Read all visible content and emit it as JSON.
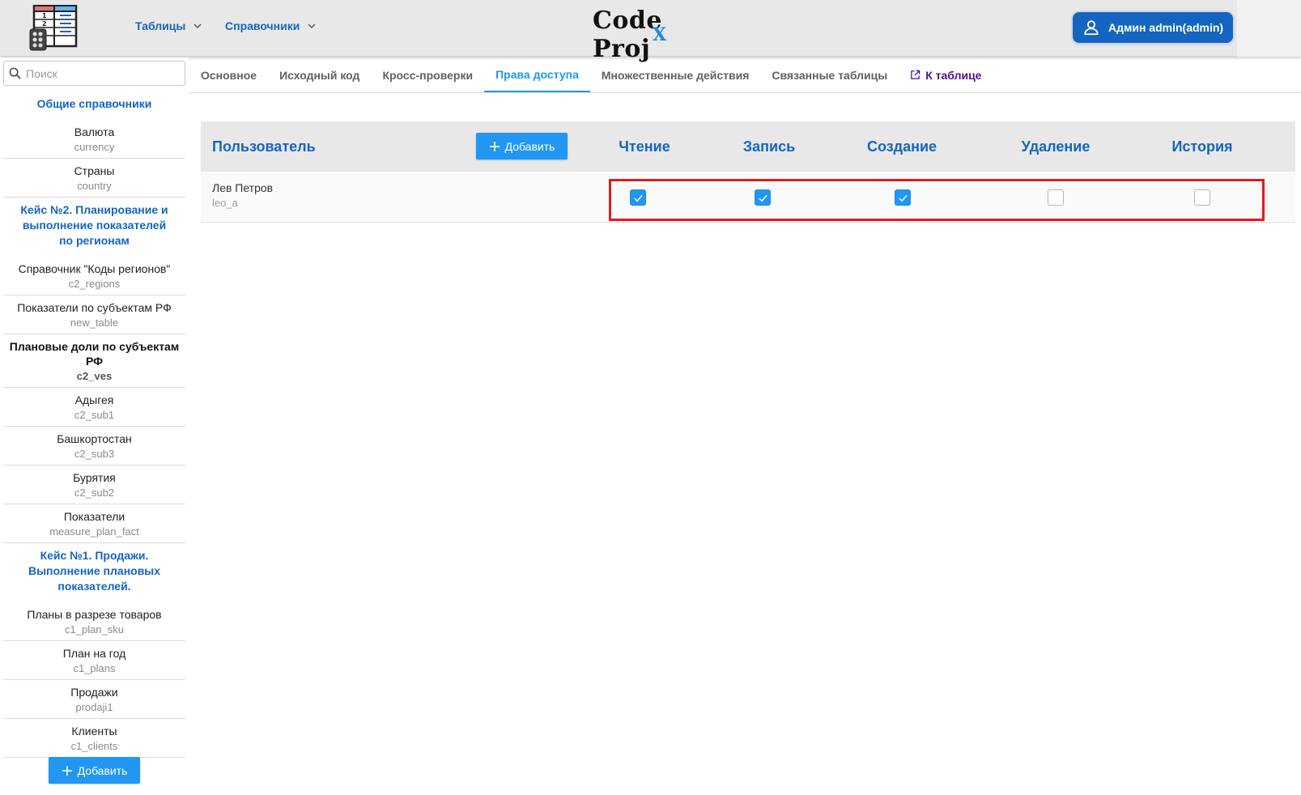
{
  "header": {
    "menu": [
      {
        "label": "Таблицы"
      },
      {
        "label": "Справочники"
      }
    ],
    "brand": {
      "main": "Code Proj",
      "accent": "X"
    },
    "user_label": "Админ admin(admin)"
  },
  "sidebar": {
    "search_placeholder": "Поиск",
    "groups": [
      {
        "title": "Общие справочники",
        "items": [
          {
            "title": "Валюта",
            "name": "currency"
          },
          {
            "title": "Страны",
            "name": "country"
          }
        ]
      },
      {
        "title": "Кейс №2. Планирование и выполнение показателей по регионам",
        "items": [
          {
            "title": "Справочник \"Коды регионов\"",
            "name": "c2_regions"
          },
          {
            "title": "Показатели по субъектам РФ",
            "name": "new_table"
          },
          {
            "title": "Плановые доли по субъектам РФ",
            "name": "c2_ves",
            "active": true
          },
          {
            "title": "Адыгея",
            "name": "c2_sub1"
          },
          {
            "title": "Башкортостан",
            "name": "c2_sub3"
          },
          {
            "title": "Бурятия",
            "name": "c2_sub2"
          },
          {
            "title": "Показатели",
            "name": "measure_plan_fact"
          }
        ]
      },
      {
        "title": "Кейс №1. Продажи. Выполнение плановых показателей.",
        "items": [
          {
            "title": "Планы в разрезе товаров",
            "name": "c1_plan_sku"
          },
          {
            "title": "План на год",
            "name": "c1_plans"
          },
          {
            "title": "Продажи",
            "name": "prodaji1"
          },
          {
            "title": "Клиенты",
            "name": "c1_clients"
          }
        ]
      }
    ],
    "add_label": "Добавить"
  },
  "tabs": [
    {
      "label": "Основное"
    },
    {
      "label": "Исходный код"
    },
    {
      "label": "Кросс-проверки"
    },
    {
      "label": "Права доступа",
      "active": true
    },
    {
      "label": "Множественные действия"
    },
    {
      "label": "Связанные таблицы"
    },
    {
      "label": "К таблице",
      "link": true
    }
  ],
  "permissions": {
    "columns": {
      "user": "Пользователь",
      "read": "Чтение",
      "write": "Запись",
      "create": "Создание",
      "delete": "Удаление",
      "history": "История"
    },
    "add_label": "Добавить",
    "rows": [
      {
        "name": "Лев Петров",
        "login": "leo_a",
        "read": true,
        "write": true,
        "create": true,
        "delete": false,
        "history": false
      }
    ]
  },
  "colors": {
    "accent": "#2196f3",
    "nav": "#1565c0",
    "highlight": "#e11b22",
    "link_tab": "#4a148c"
  }
}
